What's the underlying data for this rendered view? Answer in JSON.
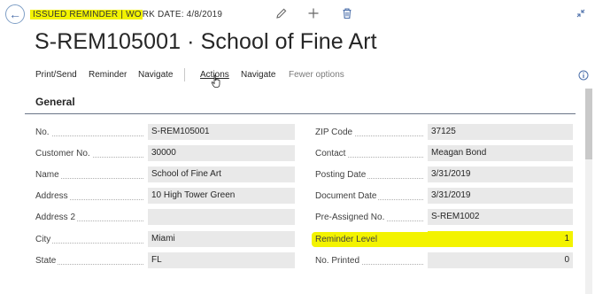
{
  "header": {
    "caption_highlighted": "ISSUED REMINDER | WO",
    "caption_rest": "RK DATE: 4/8/2019",
    "title": "S-REM105001 · School of Fine Art"
  },
  "actions": [
    {
      "label": "Print/Send"
    },
    {
      "label": "Reminder"
    },
    {
      "label": "Navigate"
    },
    {
      "label": "Actions"
    },
    {
      "label": "Navigate"
    },
    {
      "label": "Fewer options"
    }
  ],
  "section": {
    "title": "General"
  },
  "left_fields": [
    {
      "label": "No.",
      "value": "S-REM105001"
    },
    {
      "label": "Customer No.",
      "value": "30000"
    },
    {
      "label": "Name",
      "value": "School of Fine Art"
    },
    {
      "label": "Address",
      "value": "10 High Tower Green"
    },
    {
      "label": "Address 2",
      "value": ""
    },
    {
      "label": "City",
      "value": "Miami"
    },
    {
      "label": "State",
      "value": "FL"
    }
  ],
  "right_fields": [
    {
      "label": "ZIP Code",
      "value": "37125"
    },
    {
      "label": "Contact",
      "value": "Meagan Bond"
    },
    {
      "label": "Posting Date",
      "value": "3/31/2019"
    },
    {
      "label": "Document Date",
      "value": "3/31/2019"
    },
    {
      "label": "Pre-Assigned No.",
      "value": "S-REM1002"
    },
    {
      "label": "Reminder Level",
      "value": "1"
    },
    {
      "label": "No. Printed",
      "value": "0"
    }
  ],
  "icons": {
    "back": "back-arrow-icon",
    "edit": "pencil-icon",
    "new": "plus-icon",
    "delete": "trash-icon",
    "collapse": "collapse-icon",
    "info": "info-icon"
  },
  "colors": {
    "highlight": "#f3f300",
    "accent": "#4a6ea9"
  }
}
